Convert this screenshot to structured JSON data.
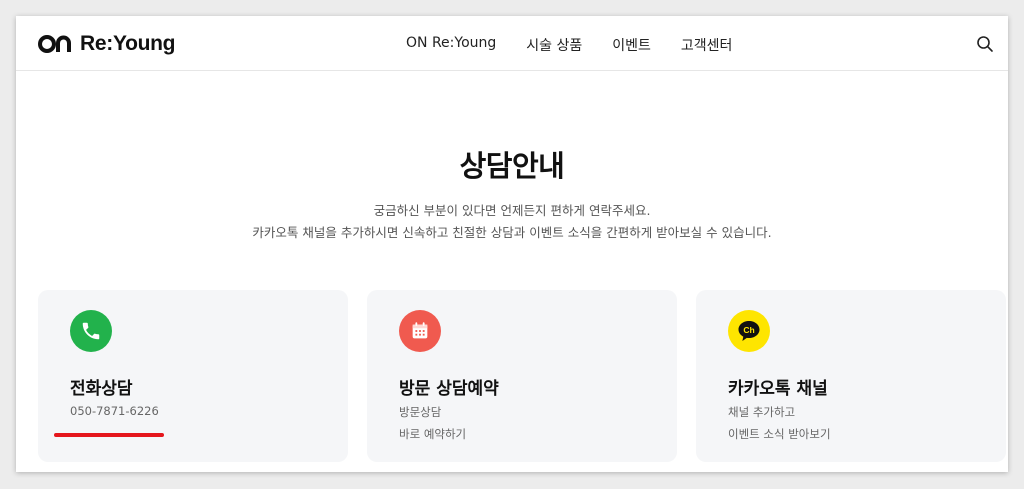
{
  "header": {
    "logo_text": "Re:Young",
    "nav": [
      "ON Re:Young",
      "시술 상품",
      "이벤트",
      "고객센터"
    ]
  },
  "hero": {
    "title": "상담안내",
    "desc_line1": "궁금하신 부분이 있다면 언제든지 편하게 연락주세요.",
    "desc_line2": "카카오톡 채널을 추가하시면 신속하고 친절한 상담과 이벤트 소식을 간편하게 받아보실 수 있습니다."
  },
  "cards": [
    {
      "title": "전화상담",
      "line1": "050-7871-6226",
      "line2": "",
      "icon": "phone-icon",
      "icon_bg": "#22b24c"
    },
    {
      "title": "방문 상담예약",
      "line1": "방문상담",
      "line2": "바로 예약하기",
      "icon": "calendar-icon",
      "icon_bg": "#f05a4f"
    },
    {
      "title": "카카오톡 채널",
      "line1": "채널 추가하고",
      "line2": "이벤트 소식 받아보기",
      "icon": "kakao-channel-icon",
      "icon_bg": "#fee500"
    }
  ],
  "colors": {
    "highlight_underline": "#e5161c",
    "card_bg": "#f5f6f8"
  }
}
